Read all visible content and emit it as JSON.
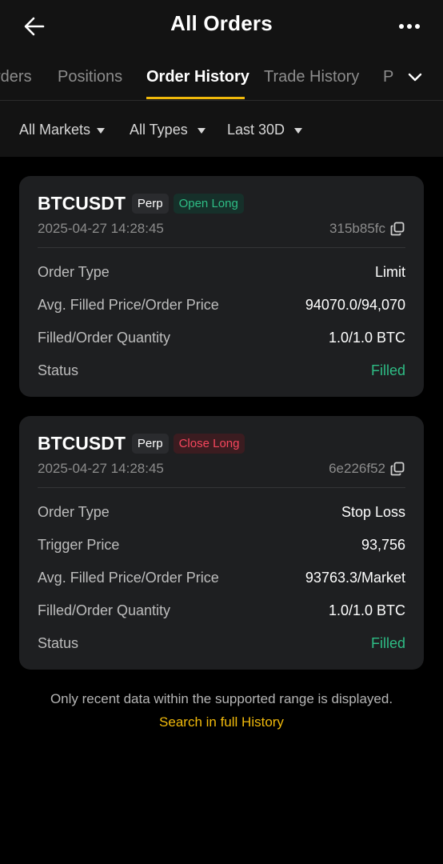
{
  "header": {
    "title": "All Orders",
    "back_icon": "arrow-left-icon",
    "more_icon": "more-dots-icon"
  },
  "tabs": [
    {
      "label": "rders",
      "active": false
    },
    {
      "label": "Positions",
      "active": false
    },
    {
      "label": "Order History",
      "active": true
    },
    {
      "label": "Trade History",
      "active": false
    },
    {
      "label": "P",
      "active": false
    }
  ],
  "filters": [
    {
      "label": "All Markets"
    },
    {
      "label": "All Types"
    },
    {
      "label": "Last 30D"
    }
  ],
  "orders": [
    {
      "symbol": "BTCUSDT",
      "market_tag": "Perp",
      "side_tag": "Open Long",
      "time": "2025-04-27 14:28:45",
      "order_id": "315b85fc",
      "rows": [
        {
          "label": "Order Type",
          "value": "Limit"
        },
        {
          "label": "Avg. Filled Price/Order Price",
          "value": "94070.0/94,070"
        },
        {
          "label": "Filled/Order Quantity",
          "value": "1.0/1.0 BTC"
        },
        {
          "label": "Status",
          "value": "Filled"
        }
      ]
    },
    {
      "symbol": "BTCUSDT",
      "market_tag": "Perp",
      "side_tag": "Close Long",
      "time": "2025-04-27 14:28:45",
      "order_id": "6e226f52",
      "rows": [
        {
          "label": "Order Type",
          "value": "Stop Loss"
        },
        {
          "label": "Trigger Price",
          "value": "93,756"
        },
        {
          "label": "Avg. Filled Price/Order Price",
          "value": "93763.3/Market"
        },
        {
          "label": "Filled/Order Quantity",
          "value": "1.0/1.0 BTC"
        },
        {
          "label": "Status",
          "value": "Filled"
        }
      ]
    }
  ],
  "footer": {
    "note": "Only recent data within the supported range is displayed.",
    "link": "Search in full History"
  },
  "colors": {
    "accent": "#f0b90b",
    "positive": "#2ebd85",
    "negative": "#f6465d",
    "card": "#1e1f21",
    "background": "#000000"
  }
}
